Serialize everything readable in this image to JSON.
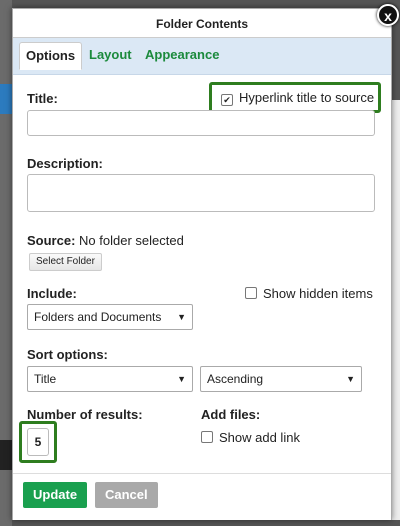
{
  "dialog": {
    "title": "Folder Contents",
    "close_glyph": "x"
  },
  "tabs": [
    {
      "label": "Options",
      "active": true
    },
    {
      "label": "Layout",
      "active": false
    },
    {
      "label": "Appearance",
      "active": false
    }
  ],
  "form": {
    "title_label": "Title:",
    "title_value": "",
    "hyperlink_label": "Hyperlink title to source",
    "hyperlink_checked": true,
    "description_label": "Description:",
    "description_value": "",
    "source_label": "Source:",
    "source_value": "No folder selected",
    "select_folder_label": "Select Folder",
    "include_label": "Include:",
    "include_value": "Folders and Documents",
    "show_hidden_label": "Show hidden items",
    "show_hidden_checked": false,
    "sort_label": "Sort options:",
    "sort_field_value": "Title",
    "sort_order_value": "Ascending",
    "results_label": "Number of results:",
    "results_value": "5",
    "add_files_label": "Add files:",
    "show_add_link_label": "Show add link",
    "show_add_link_checked": false
  },
  "footer": {
    "update_label": "Update",
    "cancel_label": "Cancel"
  },
  "colors": {
    "accent_green": "#1b8a3c",
    "highlight_green": "#2e7d1f",
    "tab_bar": "#dbe8f5",
    "update_button": "#1aa04f",
    "cancel_button": "#a9a9a9"
  }
}
